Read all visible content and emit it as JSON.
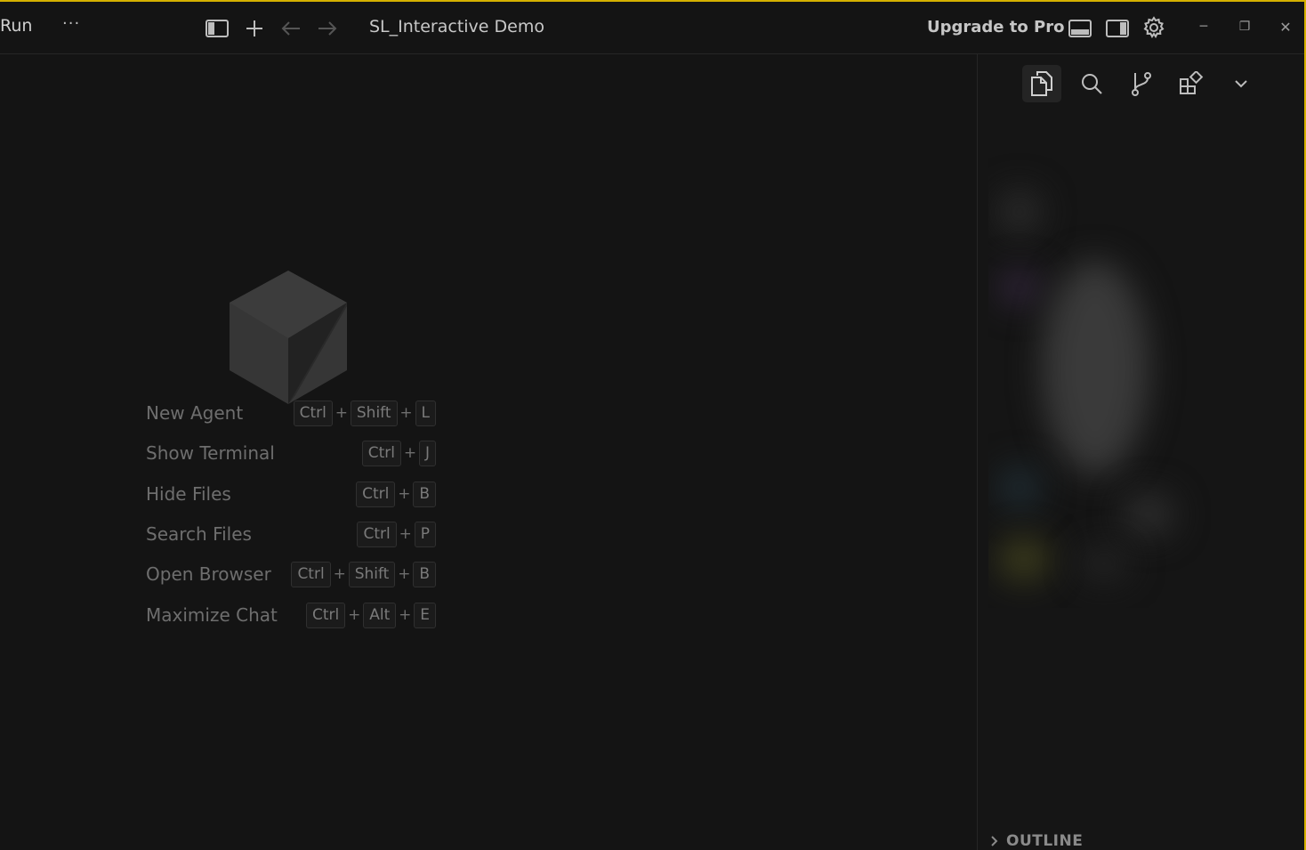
{
  "titlebar": {
    "run_label": "Run",
    "more_label": "···",
    "window_title": "SL_Interactive Demo",
    "upgrade_label": "Upgrade to Pro",
    "minimize_label": "─",
    "restore_label": "❐",
    "close_label": "✕"
  },
  "shortcuts": [
    {
      "label": "New Agent",
      "keys": [
        "Ctrl",
        "Shift",
        "L"
      ]
    },
    {
      "label": "Show Terminal",
      "keys": [
        "Ctrl",
        "J"
      ]
    },
    {
      "label": "Hide Files",
      "keys": [
        "Ctrl",
        "B"
      ]
    },
    {
      "label": "Search Files",
      "keys": [
        "Ctrl",
        "P"
      ]
    },
    {
      "label": "Open Browser",
      "keys": [
        "Ctrl",
        "Shift",
        "B"
      ]
    },
    {
      "label": "Maximize Chat",
      "keys": [
        "Ctrl",
        "Alt",
        "E"
      ]
    }
  ],
  "key_separator": "+",
  "rightpanel": {
    "outline_label": "OUTLINE"
  },
  "colors": {
    "accent_border": "#d4b000",
    "background": "#141414",
    "logo": "#3a3a3a"
  }
}
